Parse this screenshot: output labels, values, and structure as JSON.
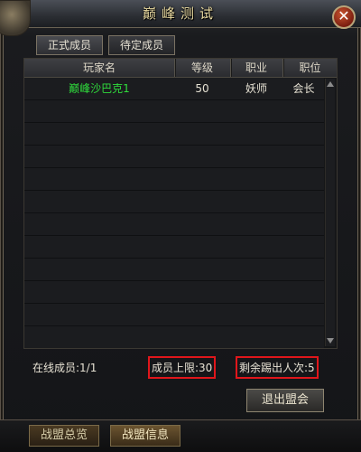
{
  "window": {
    "title": "巅峰测试"
  },
  "tabs": [
    {
      "label": "正式成员",
      "active": true
    },
    {
      "label": "待定成员",
      "active": false
    }
  ],
  "table": {
    "columns": [
      "玩家名",
      "等级",
      "职业",
      "职位"
    ],
    "rows": [
      {
        "name": "巅峰沙巴克1",
        "level": "50",
        "class": "妖师",
        "position": "会长",
        "name_color": "#2fdc3c"
      }
    ]
  },
  "footer": {
    "online": "在线成员:1/1",
    "member_limit": "成员上限:30",
    "kicks_left": "剩余踢出人次:5",
    "leave_button": "退出盟会"
  },
  "bottom_tabs": [
    {
      "label": "战盟总览",
      "active": false
    },
    {
      "label": "战盟信息",
      "active": true
    }
  ],
  "colors": {
    "highlight_box": "#e0161b",
    "title_text": "#e8d9a0"
  }
}
